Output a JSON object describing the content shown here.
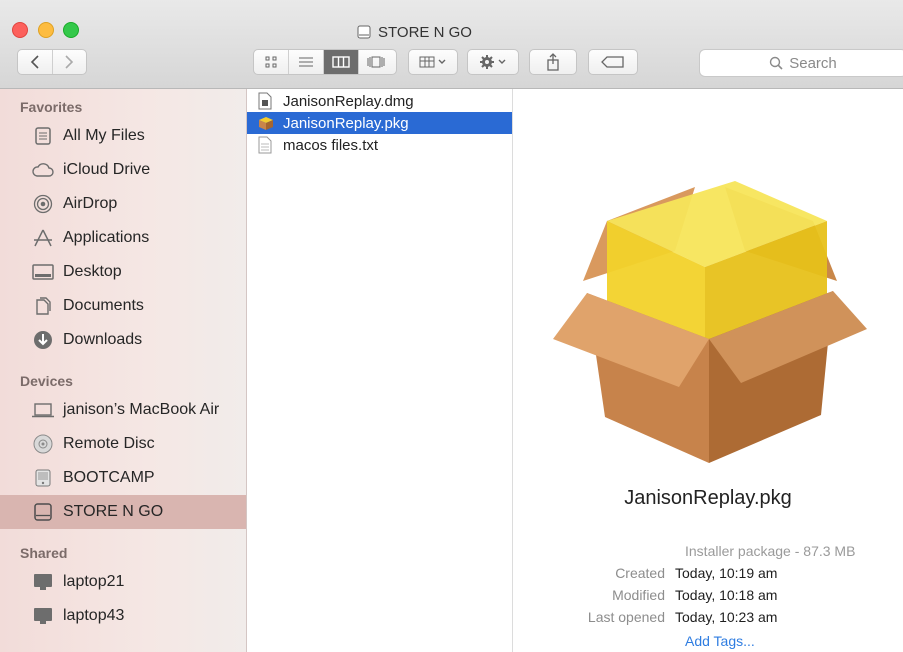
{
  "window": {
    "title": "STORE N GO"
  },
  "toolbar": {
    "search_placeholder": "Search"
  },
  "sidebar": {
    "favorites_label": "Favorites",
    "favorites": [
      {
        "label": "All My Files",
        "icon": "all-files-icon"
      },
      {
        "label": "iCloud Drive",
        "icon": "cloud-icon"
      },
      {
        "label": "AirDrop",
        "icon": "airdrop-icon"
      },
      {
        "label": "Applications",
        "icon": "applications-icon"
      },
      {
        "label": "Desktop",
        "icon": "desktop-icon"
      },
      {
        "label": "Documents",
        "icon": "documents-icon"
      },
      {
        "label": "Downloads",
        "icon": "downloads-icon"
      }
    ],
    "devices_label": "Devices",
    "devices": [
      {
        "label": "janison’s MacBook Air",
        "icon": "laptop-icon"
      },
      {
        "label": "Remote Disc",
        "icon": "disc-icon"
      },
      {
        "label": "BOOTCAMP",
        "icon": "drive-icon"
      },
      {
        "label": "STORE N GO",
        "icon": "external-drive-icon",
        "active": true
      }
    ],
    "shared_label": "Shared",
    "shared": [
      {
        "label": "laptop21",
        "icon": "monitor-icon"
      },
      {
        "label": "laptop43",
        "icon": "monitor-icon"
      }
    ]
  },
  "files": [
    {
      "name": "JanisonReplay.dmg",
      "icon": "disk-image-icon"
    },
    {
      "name": "JanisonReplay.pkg",
      "icon": "package-icon",
      "selected": true
    },
    {
      "name": "macos files.txt",
      "icon": "text-file-icon"
    }
  ],
  "preview": {
    "name": "JanisonReplay.pkg",
    "kind": "Installer package - 87.3 MB",
    "created_label": "Created",
    "created": "Today, 10:19 am",
    "modified_label": "Modified",
    "modified": "Today, 10:18 am",
    "opened_label": "Last opened",
    "opened": "Today, 10:23 am",
    "tags": "Add Tags..."
  },
  "colors": {
    "selection": "#2a6ad4",
    "sidebar_active": "#d9b5b0",
    "link": "#2f7de1"
  }
}
